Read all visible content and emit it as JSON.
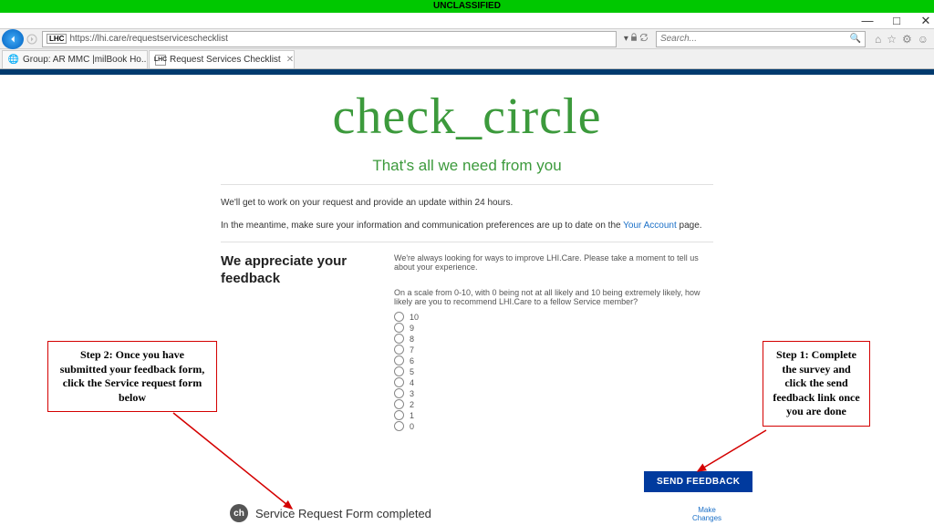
{
  "classification": "UNCLASSIFIED",
  "url": "https://lhi.care/requestserviceschecklist",
  "url_prefix": "LHC",
  "search": {
    "placeholder": "Search..."
  },
  "tabs": [
    {
      "label": "Group: AR MMC |milBook Ho..."
    },
    {
      "label": "Request Services Checklist"
    }
  ],
  "hero": {
    "title": "check_circle",
    "subtitle": "That's all we need from you"
  },
  "body": {
    "line1": "We'll get to work on your request and provide an update within 24 hours.",
    "line2_pre": "In the meantime, make sure your information and communication preferences are up to date on the ",
    "line2_link": "Your Account",
    "line2_post": " page."
  },
  "feedback": {
    "heading": "We appreciate your feedback",
    "intro": "We're always looking for ways to improve LHI.Care. Please take a moment to tell us about your experience.",
    "question": "On a scale from 0-10, with 0 being not at all likely and 10 being extremely likely, how likely are you to recommend LHI.Care to a fellow Service member?",
    "options": [
      "10",
      "9",
      "8",
      "7",
      "6",
      "5",
      "4",
      "3",
      "2",
      "1",
      "0"
    ],
    "send_label": "SEND FEEDBACK"
  },
  "srf": {
    "label": "Service Request Form completed",
    "badge": "ch"
  },
  "make_changes": {
    "l1": "Make",
    "l2": "Changes"
  },
  "callouts": {
    "step1": "Step 1: Complete the survey and click the send feedback link once you are done",
    "step2": "Step 2: Once you have submitted your feedback form, click the Service request form below"
  }
}
